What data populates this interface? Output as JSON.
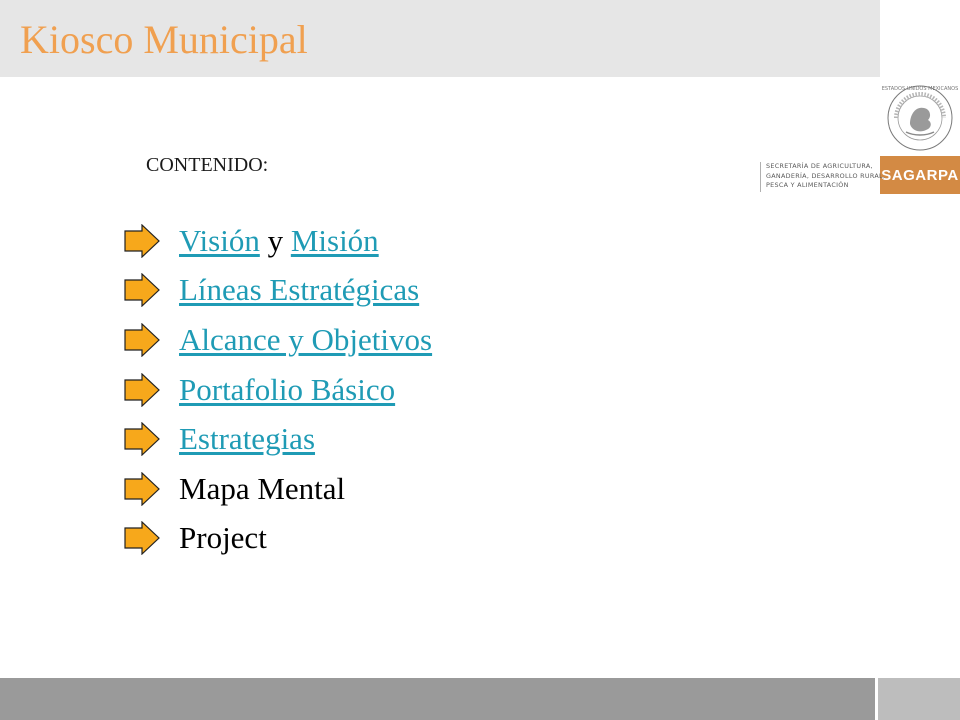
{
  "header": {
    "title": "Kiosco Municipal"
  },
  "brand": {
    "seal_text": "ESTADOS UNIDOS MEXICANOS",
    "badge_label": "SAGARPA",
    "secretaria_lines": [
      "SECRETARÍA DE AGRICULTURA,",
      "GANADERÍA, DESARROLLO RURAL,",
      "PESCA Y ALIMENTACIÓN"
    ]
  },
  "content": {
    "heading": "CONTENIDO:",
    "items": [
      {
        "link1": "Visión",
        "joiner": "y",
        "link2": "Misión"
      },
      {
        "link": "Líneas Estratégicas"
      },
      {
        "link": "Alcance y Objetivos"
      },
      {
        "link": "Portafolio Básico"
      },
      {
        "link": "Estrategias"
      },
      {
        "text": "Mapa Mental"
      },
      {
        "text": "Project"
      }
    ]
  },
  "colors": {
    "title": "#f0a050",
    "link": "#1f9bb5",
    "arrow_fill": "#f7a81b",
    "header_band": "#e6e6e6",
    "footer_band": "#9a9a9a",
    "badge": "#d38a44"
  },
  "icons": {
    "bullet": "orange-arrow-icon",
    "seal": "mexican-coat-of-arms-icon"
  }
}
